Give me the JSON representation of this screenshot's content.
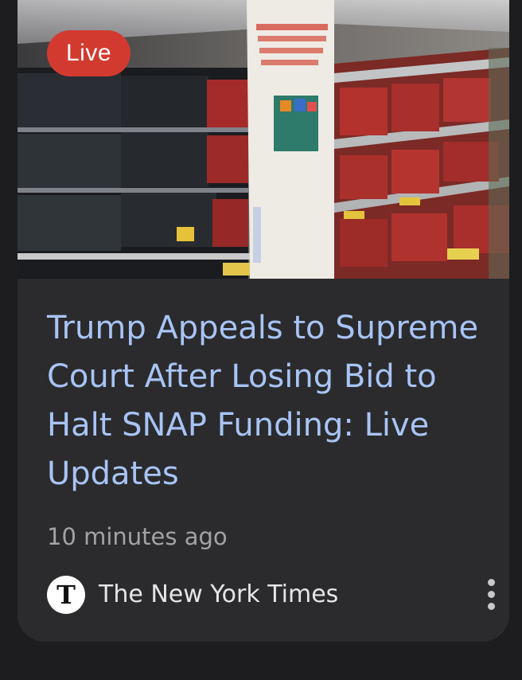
{
  "card": {
    "badge": "Live",
    "headline": "Trump Appeals to Supreme Court After Losing Bid to Halt SNAP Funding: Live Updates",
    "time": "10 minutes ago",
    "source": {
      "name": "The New York Times",
      "logo_letter": "T",
      "logo_icon": "nyt-logo-icon"
    },
    "menu_icon": "more-vert-icon"
  },
  "colors": {
    "badge": "#d23a30",
    "headline": "#a8c4f5",
    "meta": "#a3a3a6",
    "card_bg": "#2b2b2d",
    "page_bg": "#1d1d1f"
  }
}
